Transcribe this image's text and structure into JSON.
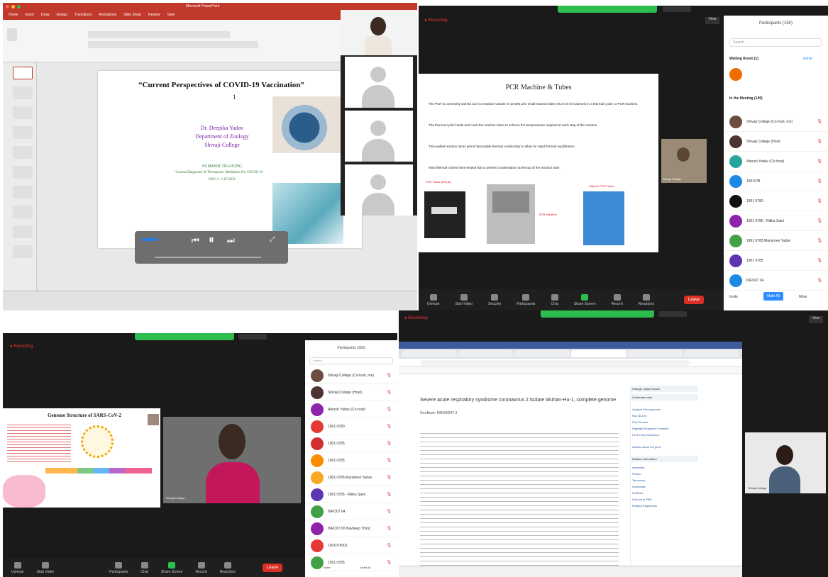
{
  "q1": {
    "slide_title": "“Current Perspectives of COVID-19 Vaccination”",
    "slide_num": "1",
    "presenter": "Dr. Deepika Yadav",
    "dept": "Department of Zoology",
    "college": "Shivaji College",
    "training": "SUMMER TRAINING",
    "training_sub": "“Current Diagnostic & Therapeutic Modalities For COVID-19",
    "day": "DAY 4 - 5.07.2021",
    "app_title": "Microsoft PowerPoint",
    "tabs": [
      "Home",
      "Insert",
      "Draw",
      "Design",
      "Transitions",
      "Animations",
      "Slide Show",
      "Review",
      "View"
    ]
  },
  "q2": {
    "slide_title": "PCR Machine & Tubes",
    "bullets": [
      "The PCR is commonly carried out in a reaction volume of 10-200 µl in small reaction tubes (0.2-0.5 ml volumes) in a thermal cycler or PCR machine.",
      "The thermal cycler heats and cools the reaction tubes to achieve the temperatures required at each step of the reaction.",
      "Thin-walled reaction tubes permit favourable thermal conductivity to allow for rapid thermal equilibration.",
      "Most thermal cyclers have heated lids to prevent condensation at the top of the reaction tube."
    ],
    "img_labels": [
      "PCR Tubes (200 µl)",
      "PCR Machine",
      "Strip for PCR Tubes"
    ],
    "recording": "Recording",
    "participants_title": "Participants (150)",
    "search": "Search",
    "waiting": "Waiting Room (1)",
    "admit": "Admit",
    "in_meeting": "In the Meeting (149)",
    "participants": [
      "Shivaji College (Co-host, me)",
      "Shivaji College (Host)",
      "Adarsh Yadav (Co-host)",
      "1901078",
      "1901 0780",
      "1901 0785 - Ritika Saini",
      "1901 0785 Manshree Yadav",
      "1901 0785",
      "INFO07 04"
    ],
    "bottom": [
      "Invite",
      "Mute All",
      "More"
    ],
    "toolbar": [
      "Unmute",
      "Start Video",
      "Security",
      "Participants",
      "Chat",
      "Share Screen",
      "Record",
      "Reactions"
    ],
    "leave": "Leave",
    "view": "View",
    "tile_name": "Shivaji College"
  },
  "q3": {
    "slide_title": "Genome Structure of SARS-CoV-2",
    "participants_title": "Participants (150)",
    "search": "Search",
    "participants": [
      "Shivaji College (Co-host, me)",
      "Shivaji College (Host)",
      "Adarsh Yadav (Co-host)",
      "1901 0780",
      "1901 0785",
      "1901 0785",
      "1901 0785 Manshree Yadav",
      "1901 0785 - Ritika Saini",
      "INFO07 04",
      "INFO07 00 Navdeep Thind",
      "1901078001",
      "1901 0785"
    ],
    "bottom": [
      "Invite",
      "Mute All"
    ],
    "toolbar": [
      "Unmute",
      "Start Video",
      "Participants",
      "Chat",
      "Share Screen",
      "Record",
      "Reactions"
    ],
    "leave": "Leave",
    "tile_name": "Shivaji College",
    "recording": "Recording"
  },
  "q4": {
    "page_heading": "Severe acute respiratory syndrome coronavirus 2 isolate Wuhan-Hu-1, complete genome",
    "accession": "GenBank: MN908947.3",
    "recording": "Recording",
    "sidebar": [
      "Change region shown",
      "Customize view",
      "Analyze this sequence",
      "Run BLAST",
      "Pick Primers",
      "Highlight Sequence Features",
      "Find in this Sequence",
      "Articles about the gene",
      "Related information",
      "Assembly",
      "Protein",
      "Taxonomy",
      "Nucleotide",
      "PubMed",
      "Full text in PMC",
      "Related Sequences"
    ],
    "tile_name": "Shivaji College",
    "view": "View"
  }
}
